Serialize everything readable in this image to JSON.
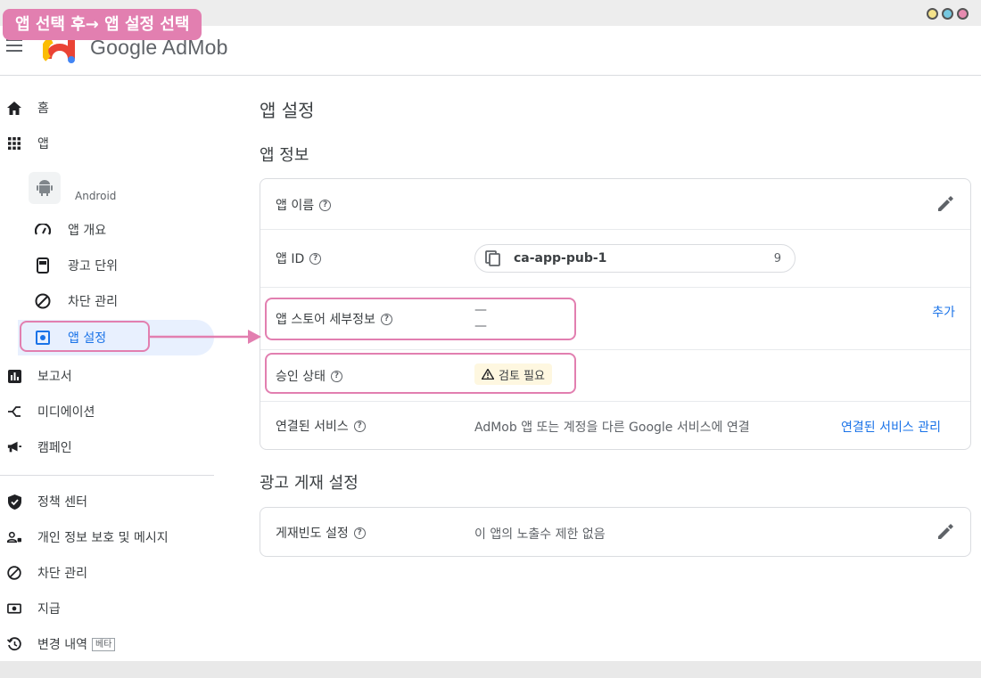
{
  "banner": "앱 선택 후→ 앱 설정 선택",
  "header": {
    "brand": "Google AdMob"
  },
  "sidebar": {
    "home": "홈",
    "apps": "앱",
    "app_platform": "Android",
    "app_overview": "앱 개요",
    "ad_units": "광고 단위",
    "blocking_controls": "차단 관리",
    "app_settings": "앱 설정",
    "reports": "보고서",
    "mediation": "미디에이션",
    "campaigns": "캠페인",
    "policy_center": "정책 센터",
    "privacy_messaging": "개인 정보 보호 및 메시지",
    "blocking_controls_2": "차단 관리",
    "payments": "지급",
    "change_history": "변경 내역",
    "beta_badge": "베타"
  },
  "main": {
    "page_title": "앱 설정",
    "app_info_title": "앱 정보",
    "app_name_label": "앱 이름",
    "app_id_label": "앱 ID",
    "app_id_value": "ca-app-pub-1",
    "app_id_tail": "9",
    "store_details_label": "앱 스토어 세부정보",
    "store_details_line1": "—",
    "store_details_line2": "—",
    "add_link": "추가",
    "approval_label": "승인 상태",
    "approval_chip": "검토 필요",
    "linked_label": "연결된 서비스",
    "linked_value": "AdMob 앱 또는 계정을 다른 Google 서비스에 연결",
    "linked_link": "연결된 서비스 관리",
    "serving_title": "광고 게재 설정",
    "frequency_label": "게재빈도 설정",
    "frequency_value": "이 앱의 노출수 제한 없음",
    "help_glyph": "?"
  },
  "colors": {
    "accent": "#1a73e8",
    "highlight": "#e27fb0",
    "active_bg": "#e8f0fe",
    "warn_bg": "#fef7e0"
  }
}
